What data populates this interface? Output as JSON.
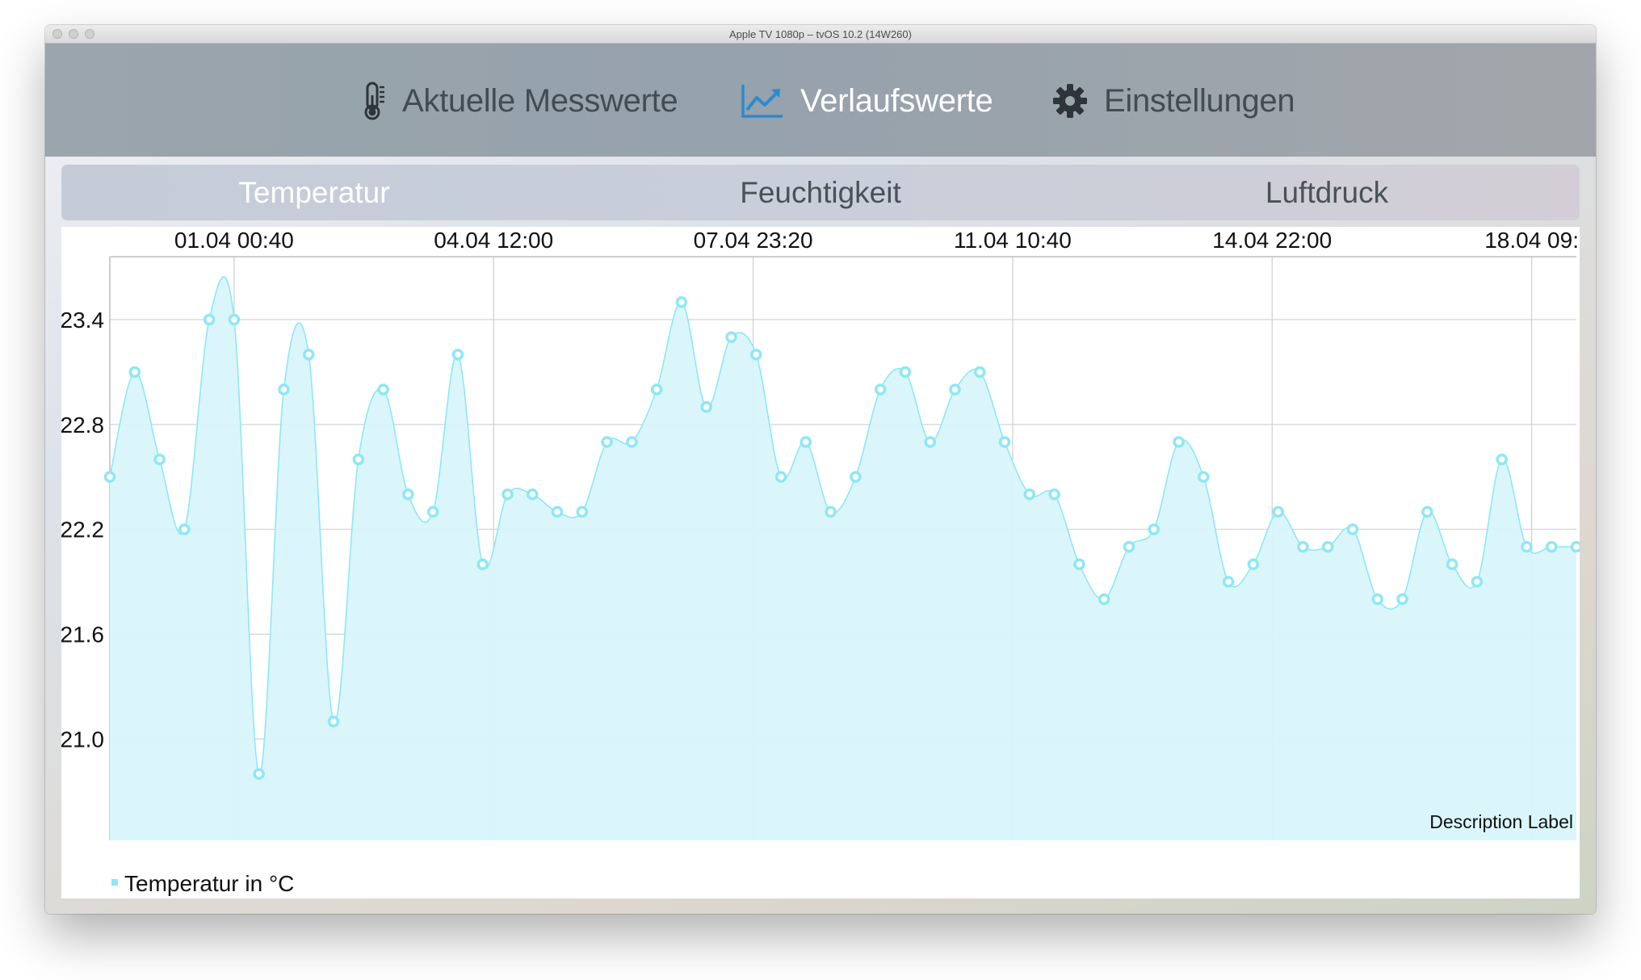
{
  "window": {
    "title": "Apple TV 1080p – tvOS 10.2 (14W260)"
  },
  "topnav": {
    "items": [
      {
        "label": "Aktuelle Messwerte",
        "icon": "thermometer-icon"
      },
      {
        "label": "Verlaufswerte",
        "icon": "line-chart-icon",
        "active": true
      },
      {
        "label": "Einstellungen",
        "icon": "gear-icon"
      }
    ]
  },
  "segments": {
    "items": [
      {
        "label": "Temperatur",
        "active": true
      },
      {
        "label": "Feuchtigkeit"
      },
      {
        "label": "Luftdruck"
      }
    ]
  },
  "chart_data": {
    "type": "area",
    "title": "",
    "xlabel": "",
    "ylabel": "",
    "x_tick_labels": [
      "01.04 00:40",
      "04.04 12:00",
      "07.04 23:20",
      "11.04 10:40",
      "14.04 22:00",
      "18.04 09:"
    ],
    "y_tick_labels": [
      "23.4",
      "22.8",
      "22.2",
      "21.6",
      "21.0"
    ],
    "ylim": [
      20.42,
      23.76
    ],
    "grid": true,
    "legend_position": "bottom-left",
    "description_label": "Description Label",
    "color": "#8ee7f5",
    "fill_color": "#d8f6fb",
    "series": [
      {
        "name": "Temperatur in °C",
        "values": [
          22.5,
          23.1,
          22.6,
          22.2,
          23.4,
          23.4,
          20.8,
          23.0,
          23.2,
          21.1,
          22.6,
          23.0,
          22.4,
          22.3,
          23.2,
          22.0,
          22.4,
          22.4,
          22.3,
          22.3,
          22.7,
          22.7,
          23.0,
          23.5,
          22.9,
          23.3,
          23.2,
          22.5,
          22.7,
          22.3,
          22.5,
          23.0,
          23.1,
          22.7,
          23.0,
          23.1,
          22.7,
          22.4,
          22.4,
          22.0,
          21.8,
          22.1,
          22.2,
          22.7,
          22.5,
          21.9,
          22.0,
          22.3,
          22.1,
          22.1,
          22.2,
          21.8,
          21.8,
          22.3,
          22.0,
          21.9,
          22.6,
          22.1,
          22.1,
          22.1
        ]
      }
    ]
  }
}
